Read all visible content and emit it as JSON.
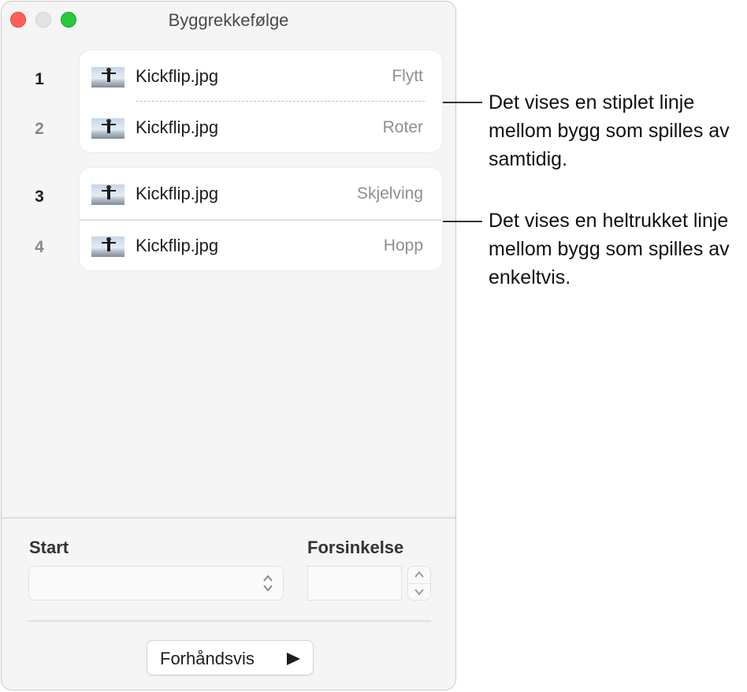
{
  "window": {
    "title": "Byggrekkefølge"
  },
  "builds": [
    {
      "number": "1",
      "file": "Kickflip.jpg",
      "effect": "Flytt"
    },
    {
      "number": "2",
      "file": "Kickflip.jpg",
      "effect": "Roter"
    },
    {
      "number": "3",
      "file": "Kickflip.jpg",
      "effect": "Skjelving"
    },
    {
      "number": "4",
      "file": "Kickflip.jpg",
      "effect": "Hopp"
    }
  ],
  "controls": {
    "start_label": "Start",
    "start_value": "",
    "delay_label": "Forsinkelse",
    "delay_value": "",
    "preview_label": "Forhåndsvis"
  },
  "callouts": {
    "dashed": "Det vises en stiplet linje mellom bygg som spilles av samtidig.",
    "solid": "Det vises en heltrukket linje mellom bygg som spilles av enkeltvis."
  },
  "icons": {
    "thumbnail": "kickflip-thumbnail-icon",
    "select": "chevron-updown-icon",
    "stepper_up": "chevron-up-icon",
    "stepper_down": "chevron-down-icon",
    "play": "play-icon"
  },
  "colors": {
    "close": "#fe5f57",
    "minimize": "#e3e3e3",
    "maximize": "#28c840"
  }
}
